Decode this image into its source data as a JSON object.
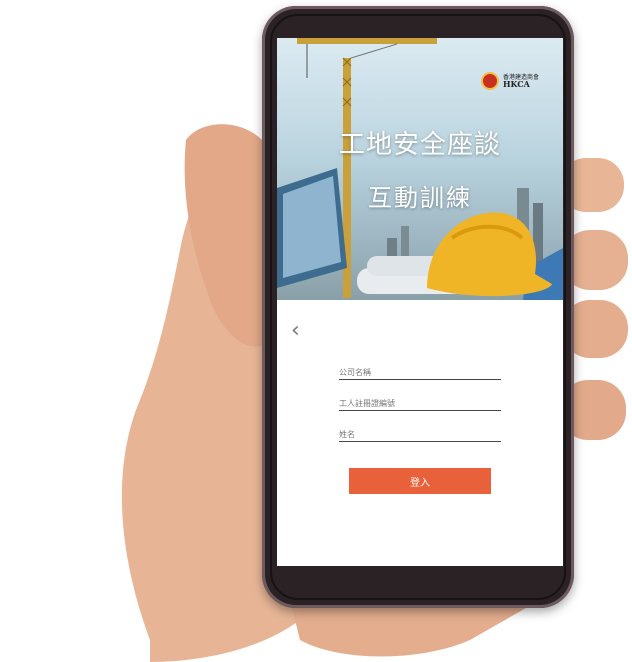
{
  "logo": {
    "org_name": "香港建造商會",
    "abbr": "HKCA"
  },
  "banner": {
    "title_line1": "工地安全座談",
    "title_line2": "互動訓練"
  },
  "form": {
    "back_icon": "‹",
    "company_placeholder": "公司名稱",
    "worker_id_placeholder": "工人註冊證編號",
    "name_placeholder": "姓名",
    "login_label": "登入"
  },
  "colors": {
    "login_button": "#e8613b",
    "helmet": "#f0b526",
    "logo_red": "#c8311f"
  }
}
